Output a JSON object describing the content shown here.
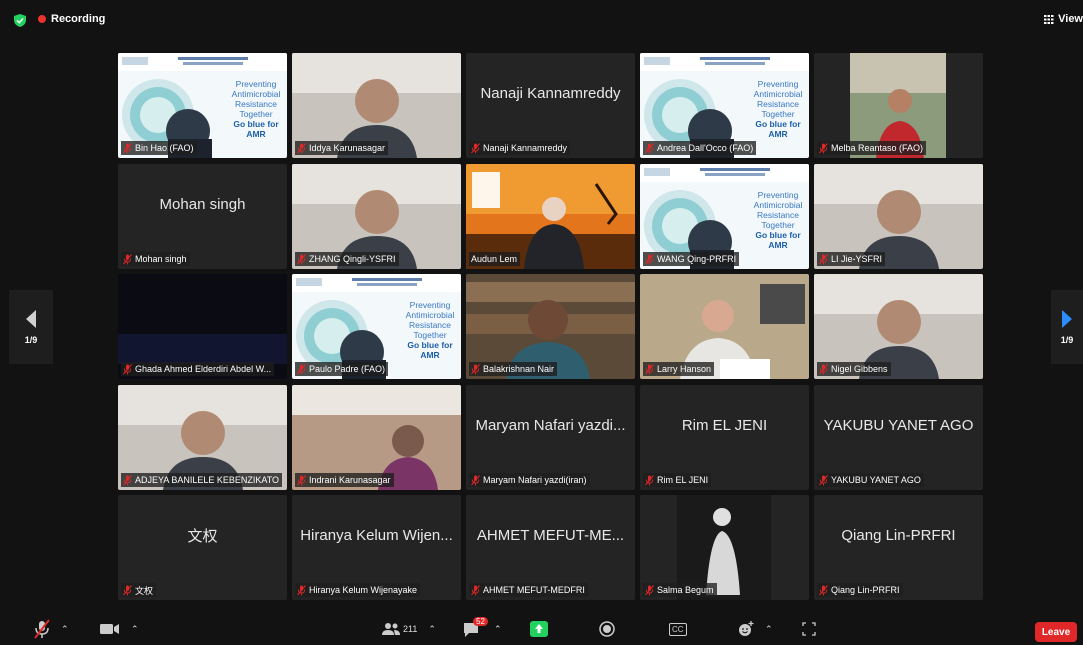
{
  "topbar": {
    "recording_label": "Recording",
    "view_label": "View"
  },
  "pagination": {
    "left": "1/9",
    "right": "1/9"
  },
  "participants": [
    {
      "name": "Bin Hao (FAO)",
      "display": "",
      "kind": "slide",
      "muted": true
    },
    {
      "name": "Iddya Karunasagar",
      "display": "",
      "kind": "video",
      "muted": true
    },
    {
      "name": "Nanaji Kannamreddy",
      "display": "Nanaji Kannamreddy",
      "kind": "name",
      "muted": true
    },
    {
      "name": "Andrea Dall'Occo (FAO)",
      "display": "",
      "kind": "slide",
      "muted": true
    },
    {
      "name": "Melba Reantaso (FAO)",
      "display": "",
      "kind": "photo",
      "muted": true
    },
    {
      "name": "Mohan singh",
      "display": "Mohan singh",
      "kind": "name",
      "muted": true
    },
    {
      "name": "ZHANG Qingli-YSFRI",
      "display": "",
      "kind": "video",
      "muted": true
    },
    {
      "name": "Audun Lem",
      "display": "",
      "kind": "sunset",
      "muted": false,
      "active": true
    },
    {
      "name": "WANG Qing-PRFRI",
      "display": "",
      "kind": "slide",
      "muted": true
    },
    {
      "name": "LI Jie-YSFRI",
      "display": "",
      "kind": "video",
      "muted": true
    },
    {
      "name": "Ghada Ahmed Elderdiri Abdel W...",
      "display": "",
      "kind": "dark",
      "muted": true
    },
    {
      "name": "Paulo Padre (FAO)",
      "display": "",
      "kind": "slide",
      "muted": true
    },
    {
      "name": "Balakrishnan Nair",
      "display": "",
      "kind": "books",
      "muted": true
    },
    {
      "name": "Larry Hanson",
      "display": "",
      "kind": "office",
      "muted": true
    },
    {
      "name": "Nigel Gibbens",
      "display": "",
      "kind": "video",
      "muted": true
    },
    {
      "name": "ADJEYA BANILELE KEBENZIKATO",
      "display": "",
      "kind": "video",
      "muted": true
    },
    {
      "name": "Indrani Karunasagar",
      "display": "",
      "kind": "tiles",
      "muted": true
    },
    {
      "name": "Maryam Nafari yazdi(iran)",
      "display": "Maryam Nafari yazdi...",
      "kind": "name",
      "muted": true
    },
    {
      "name": "Rim EL JENI",
      "display": "Rim EL JENI",
      "kind": "name",
      "muted": true
    },
    {
      "name": "YAKUBU YANET AGO",
      "display": "YAKUBU YANET AGO",
      "kind": "name",
      "muted": true
    },
    {
      "name": "文权",
      "display": "文权",
      "kind": "name",
      "muted": true
    },
    {
      "name": "Hiranya Kelum Wijenayake",
      "display": "Hiranya Kelum Wijen...",
      "kind": "name",
      "muted": true
    },
    {
      "name": "AHMET MEFUT-MEDFRI",
      "display": "AHMET MEFUT-ME...",
      "kind": "name",
      "muted": true
    },
    {
      "name": "Salma Begum",
      "display": "",
      "kind": "bw",
      "muted": true
    },
    {
      "name": "Qiang Lin-PRFRI",
      "display": "Qiang Lin-PRFRI",
      "kind": "name",
      "muted": true
    }
  ],
  "slide_text": {
    "line1": "Preventing",
    "line2": "Antimicrobial",
    "line3": "Resistance",
    "line4": "Together",
    "line5": "Go blue for",
    "line6": "AMR"
  },
  "toolbar": {
    "participants_count": "211",
    "chat_badge": "52",
    "leave_label": "Leave",
    "cc_label": "CC"
  },
  "colors": {
    "active_border": "#23d160",
    "recording": "#e8332f",
    "leave": "#e02828",
    "share": "#23d160"
  }
}
